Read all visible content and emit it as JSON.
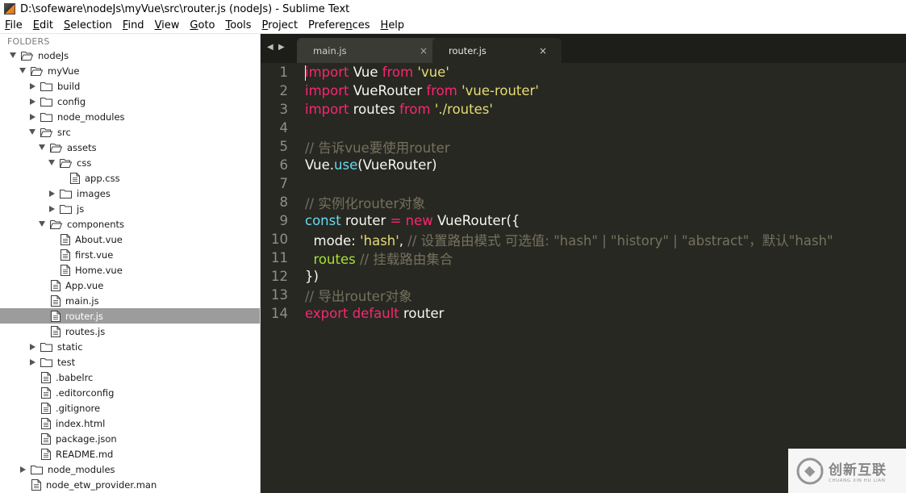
{
  "window": {
    "title": "D:\\sofeware\\nodeJs\\myVue\\src\\router.js (nodeJs) - Sublime Text"
  },
  "menubar": {
    "items": [
      {
        "label": "File",
        "underline": "F",
        "rest": "ile"
      },
      {
        "label": "Edit",
        "underline": "E",
        "rest": "dit"
      },
      {
        "label": "Selection",
        "underline": "S",
        "rest": "election"
      },
      {
        "label": "Find",
        "underline": "F",
        "rest": "ind",
        "underline_index": 1
      },
      {
        "label": "View",
        "underline": "V",
        "rest": "iew"
      },
      {
        "label": "Goto",
        "underline": "G",
        "rest": "oto"
      },
      {
        "label": "Tools",
        "underline": "T",
        "rest": "ools"
      },
      {
        "label": "Project",
        "underline": "P",
        "rest": "roject"
      },
      {
        "label": "Preferences",
        "underline": "n",
        "rest": "Preferences"
      },
      {
        "label": "Help",
        "underline": "H",
        "rest": "elp"
      }
    ]
  },
  "sidebar": {
    "header": "FOLDERS",
    "tree": [
      {
        "label": "nodeJs",
        "type": "folder",
        "depth": 0,
        "expanded": true,
        "selected": false
      },
      {
        "label": "myVue",
        "type": "folder",
        "depth": 1,
        "expanded": true,
        "selected": false
      },
      {
        "label": "build",
        "type": "folder",
        "depth": 2,
        "expanded": false,
        "selected": false
      },
      {
        "label": "config",
        "type": "folder",
        "depth": 2,
        "expanded": false,
        "selected": false
      },
      {
        "label": "node_modules",
        "type": "folder",
        "depth": 2,
        "expanded": false,
        "selected": false
      },
      {
        "label": "src",
        "type": "folder",
        "depth": 2,
        "expanded": true,
        "selected": false
      },
      {
        "label": "assets",
        "type": "folder",
        "depth": 3,
        "expanded": true,
        "selected": false
      },
      {
        "label": "css",
        "type": "folder",
        "depth": 4,
        "expanded": true,
        "selected": false
      },
      {
        "label": "app.css",
        "type": "file",
        "depth": 5,
        "selected": false
      },
      {
        "label": "images",
        "type": "folder",
        "depth": 4,
        "expanded": false,
        "selected": false
      },
      {
        "label": "js",
        "type": "folder",
        "depth": 4,
        "expanded": false,
        "selected": false
      },
      {
        "label": "components",
        "type": "folder",
        "depth": 3,
        "expanded": true,
        "selected": false
      },
      {
        "label": "About.vue",
        "type": "file",
        "depth": 4,
        "selected": false
      },
      {
        "label": "first.vue",
        "type": "file",
        "depth": 4,
        "selected": false
      },
      {
        "label": "Home.vue",
        "type": "file",
        "depth": 4,
        "selected": false
      },
      {
        "label": "App.vue",
        "type": "file",
        "depth": 3,
        "selected": false
      },
      {
        "label": "main.js",
        "type": "file",
        "depth": 3,
        "selected": false
      },
      {
        "label": "router.js",
        "type": "file",
        "depth": 3,
        "selected": true
      },
      {
        "label": "routes.js",
        "type": "file",
        "depth": 3,
        "selected": false
      },
      {
        "label": "static",
        "type": "folder",
        "depth": 2,
        "expanded": false,
        "selected": false
      },
      {
        "label": "test",
        "type": "folder",
        "depth": 2,
        "expanded": false,
        "selected": false
      },
      {
        "label": ".babelrc",
        "type": "file",
        "depth": 2,
        "selected": false
      },
      {
        "label": ".editorconfig",
        "type": "file",
        "depth": 2,
        "selected": false
      },
      {
        "label": ".gitignore",
        "type": "file",
        "depth": 2,
        "selected": false
      },
      {
        "label": "index.html",
        "type": "file",
        "depth": 2,
        "selected": false
      },
      {
        "label": "package.json",
        "type": "file",
        "depth": 2,
        "selected": false
      },
      {
        "label": "README.md",
        "type": "file",
        "depth": 2,
        "selected": false
      },
      {
        "label": "node_modules",
        "type": "folder",
        "depth": 1,
        "expanded": false,
        "selected": false
      },
      {
        "label": "node_etw_provider.man",
        "type": "file",
        "depth": 1,
        "selected": false
      }
    ]
  },
  "editor": {
    "tab_nav_prev": "◀",
    "tab_nav_next": "▶",
    "tabs": [
      {
        "label": "main.js",
        "close": "×",
        "active": false
      },
      {
        "label": "router.js",
        "close": "×",
        "active": true
      }
    ],
    "cursor_line": 1,
    "lines": [
      {
        "no": "1",
        "tokens": [
          [
            "keyword",
            "import"
          ],
          [
            "plain",
            " Vue "
          ],
          [
            "keyword",
            "from"
          ],
          [
            "plain",
            " "
          ],
          [
            "string",
            "'vue'"
          ]
        ]
      },
      {
        "no": "2",
        "tokens": [
          [
            "keyword",
            "import"
          ],
          [
            "plain",
            " VueRouter "
          ],
          [
            "keyword",
            "from"
          ],
          [
            "plain",
            " "
          ],
          [
            "string",
            "'vue-router'"
          ]
        ]
      },
      {
        "no": "3",
        "tokens": [
          [
            "keyword",
            "import"
          ],
          [
            "plain",
            " routes "
          ],
          [
            "keyword",
            "from"
          ],
          [
            "plain",
            " "
          ],
          [
            "string",
            "'./routes'"
          ]
        ]
      },
      {
        "no": "4",
        "tokens": []
      },
      {
        "no": "5",
        "tokens": [
          [
            "comment",
            "// 告诉vue要使用router"
          ]
        ]
      },
      {
        "no": "6",
        "tokens": [
          [
            "plain",
            "Vue."
          ],
          [
            "func",
            "use"
          ],
          [
            "plain",
            "(VueRouter)"
          ]
        ]
      },
      {
        "no": "7",
        "tokens": []
      },
      {
        "no": "8",
        "tokens": [
          [
            "comment",
            "// 实例化router对象"
          ]
        ]
      },
      {
        "no": "9",
        "tokens": [
          [
            "func",
            "const"
          ],
          [
            "plain",
            " router "
          ],
          [
            "keyword",
            "="
          ],
          [
            "plain",
            " "
          ],
          [
            "keyword",
            "new"
          ],
          [
            "plain",
            " VueRouter({"
          ]
        ]
      },
      {
        "no": "10",
        "tokens": [
          [
            "plain",
            "  mode: "
          ],
          [
            "string",
            "'hash'"
          ],
          [
            "plain",
            ", "
          ],
          [
            "comment",
            "// 设置路由模式 可选值: \"hash\" | \"history\" | \"abstract\"，默认\"hash\""
          ]
        ]
      },
      {
        "no": "11",
        "tokens": [
          [
            "plain",
            "  "
          ],
          [
            "green",
            "routes"
          ],
          [
            "plain",
            " "
          ],
          [
            "comment",
            "// 挂载路由集合"
          ]
        ]
      },
      {
        "no": "12",
        "tokens": [
          [
            "plain",
            "})"
          ]
        ]
      },
      {
        "no": "13",
        "tokens": [
          [
            "comment",
            "// 导出router对象"
          ]
        ]
      },
      {
        "no": "14",
        "tokens": [
          [
            "keyword",
            "export"
          ],
          [
            "plain",
            " "
          ],
          [
            "keyword",
            "default"
          ],
          [
            "plain",
            " router"
          ]
        ]
      }
    ]
  },
  "watermark": {
    "cn": "创新互联",
    "en": "CHUANG XIN HU LIAN"
  },
  "colors": {
    "editor_bg": "#272822",
    "tabbar_bg": "#1d1e19",
    "keyword": "#f92672",
    "string": "#e6db74",
    "comment": "#75715e",
    "func": "#66d9ef",
    "plain": "#f8f8f2",
    "green": "#a6e22e",
    "line_number": "#8f908a",
    "sidebar_selected": "#9c9c9c"
  }
}
